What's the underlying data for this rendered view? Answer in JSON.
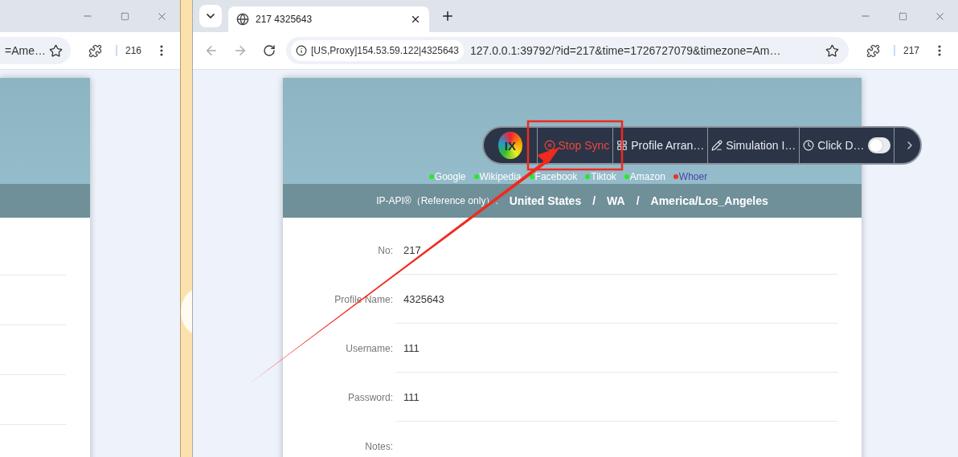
{
  "left_window": {
    "address_fragment": "=Ame…",
    "profile_badge": "216"
  },
  "right_window": {
    "tab": {
      "title": "217 4325643"
    },
    "proxy_chip": "[US,Proxy]154.53.59.122|4325643",
    "url": "127.0.0.1:39792/?id=217&time=1726727079&timezone=Am…",
    "profile_badge": "217"
  },
  "page": {
    "links": [
      {
        "label": "Google",
        "color": "#22ee22",
        "ok": true
      },
      {
        "label": "Wikipedia",
        "color": "#22ee22",
        "ok": true
      },
      {
        "label": "Facebook",
        "color": "#22ee22",
        "ok": true
      },
      {
        "label": "Tiktok",
        "color": "#22ee22",
        "ok": true
      },
      {
        "label": "Amazon",
        "color": "#22ee22",
        "ok": true
      },
      {
        "label": "Whoer",
        "color": "#ee3322",
        "ok": false
      }
    ],
    "ip_api": {
      "label": "IP-API®（Reference only）:",
      "country": "United States",
      "region": "WA",
      "timezone": "America/Los_Angeles",
      "separators": [
        "/",
        "/"
      ]
    },
    "fields": [
      {
        "label": "No:",
        "value": "217"
      },
      {
        "label": "Profile Name:",
        "value": "4325643"
      },
      {
        "label": "Username:",
        "value": "111"
      },
      {
        "label": "Password:",
        "value": "111"
      },
      {
        "label": "Notes:"
      }
    ]
  },
  "sync_toolbar": {
    "logo": "IX",
    "items": [
      {
        "kind": "stop",
        "label": "Stop Sync"
      },
      {
        "kind": "arrange",
        "label": "Profile Arran…"
      },
      {
        "kind": "simulate",
        "label": "Simulation I…"
      },
      {
        "kind": "click",
        "label": "Click D…",
        "on": false
      }
    ]
  }
}
